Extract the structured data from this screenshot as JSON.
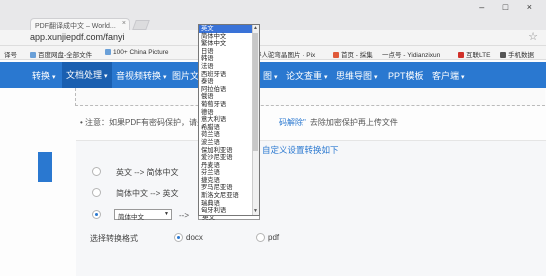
{
  "browser": {
    "tab_title": "PDF翻译成中文 – World...",
    "tab_close": "×",
    "window_controls": "– □ ×",
    "url": "app.xunjiepdf.com/fanyi",
    "star": "☆",
    "bookmarks": [
      "译号",
      "百度网盘-全部文件",
      "100+ China Picture",
      "9",
      "伴人驼弯晶图片 · Pix",
      "首页 - 採集",
      "一点号 - Yidianzixun",
      "互联LTE",
      "手机数据"
    ]
  },
  "nav": {
    "items": [
      {
        "label": "转换"
      },
      {
        "label": "文档处理"
      },
      {
        "label": "音视频转换"
      },
      {
        "label": "图片文字"
      },
      {
        "label": "图"
      },
      {
        "label": "论文查重"
      },
      {
        "label": "思维导图"
      },
      {
        "label": "PPT模板"
      },
      {
        "label": "客户端"
      }
    ]
  },
  "notice": {
    "prefix": "• 注意：如果PDF有密码保护，请先",
    "link": "码解除\"",
    "suffix": "去除加密保护再上传文件"
  },
  "custom_link": "自定义设置转换如下",
  "options": {
    "opt1": {
      "from": "英文",
      "arrow": "-->",
      "to": "简体中文"
    },
    "opt2": {
      "from": "简体中文",
      "arrow": "-->",
      "to": "英文"
    },
    "opt3": {
      "from_select": "简体中文",
      "arrow": "-->",
      "to_select": "英文"
    }
  },
  "format": {
    "label": "选择转换格式",
    "docx": "docx",
    "pdf": "pdf",
    "selected": "docx"
  },
  "language_dropdown": {
    "selected": "英文",
    "options": [
      "英文",
      "简体中文",
      "繁体中文",
      "日语",
      "韩语",
      "法语",
      "西班牙语",
      "泰语",
      "阿拉伯语",
      "俄语",
      "葡萄牙语",
      "德语",
      "意大利语",
      "希腊语",
      "荷兰语",
      "波兰语",
      "保加利亚语",
      "爱沙尼亚语",
      "丹麦语",
      "芬兰语",
      "捷克语",
      "罗马尼亚语",
      "斯洛文尼亚语",
      "瑞典语",
      "匈牙利语"
    ]
  },
  "colors": {
    "nav_blue": "#2a78d0",
    "selected_option": "#3a73d8"
  }
}
